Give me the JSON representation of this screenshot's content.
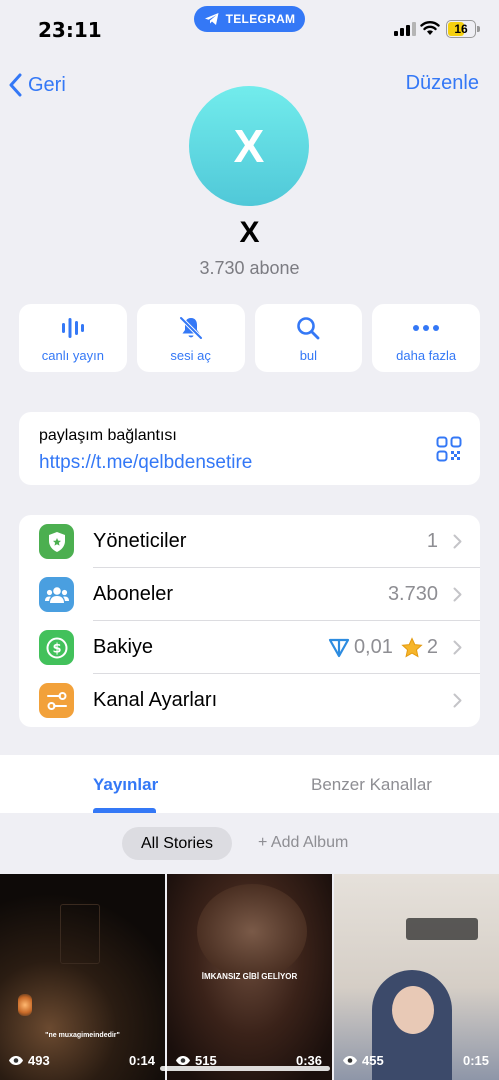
{
  "status_bar": {
    "time": "23:11",
    "app_pill": "TELEGRAM",
    "battery": "16"
  },
  "nav": {
    "back_label": "Geri",
    "edit_label": "Düzenle"
  },
  "profile": {
    "avatar_letter": "X",
    "name": "X",
    "subscribers": "3.730 abone"
  },
  "actions": [
    {
      "label": "canlı yayın",
      "icon": "live-stream-icon"
    },
    {
      "label": "sesi aç",
      "icon": "bell-muted-icon"
    },
    {
      "label": "bul",
      "icon": "search-icon"
    },
    {
      "label": "daha fazla",
      "icon": "more-icon"
    }
  ],
  "share_link": {
    "label": "paylaşım bağlantısı",
    "url": "https://t.me/qelbdensetire"
  },
  "menu": {
    "admins": {
      "label": "Yöneticiler",
      "value": "1"
    },
    "subscribers": {
      "label": "Aboneler",
      "value": "3.730"
    },
    "balance": {
      "label": "Bakiye",
      "ton": "0,01",
      "stars": "2"
    },
    "settings": {
      "label": "Kanal Ayarları"
    }
  },
  "tabs": {
    "posts": "Yayınlar",
    "similar": "Benzer Kanallar"
  },
  "stories": {
    "all": "All Stories",
    "add_album": "+ Add Album"
  },
  "media": [
    {
      "views": "493",
      "duration": "0:14",
      "caption": "\"ne muxagimeindedir\""
    },
    {
      "views": "515",
      "duration": "0:36",
      "caption": "İMKANSIZ GİBİ GELİYOR"
    },
    {
      "views": "455",
      "duration": "0:15",
      "caption": ""
    }
  ],
  "colors": {
    "accent": "#3478f6",
    "admins_icon_bg": "#4caf50",
    "subscribers_icon_bg": "#4a9fe0",
    "balance_icon_bg": "#42c15b",
    "settings_icon_bg": "#f2a13a"
  }
}
